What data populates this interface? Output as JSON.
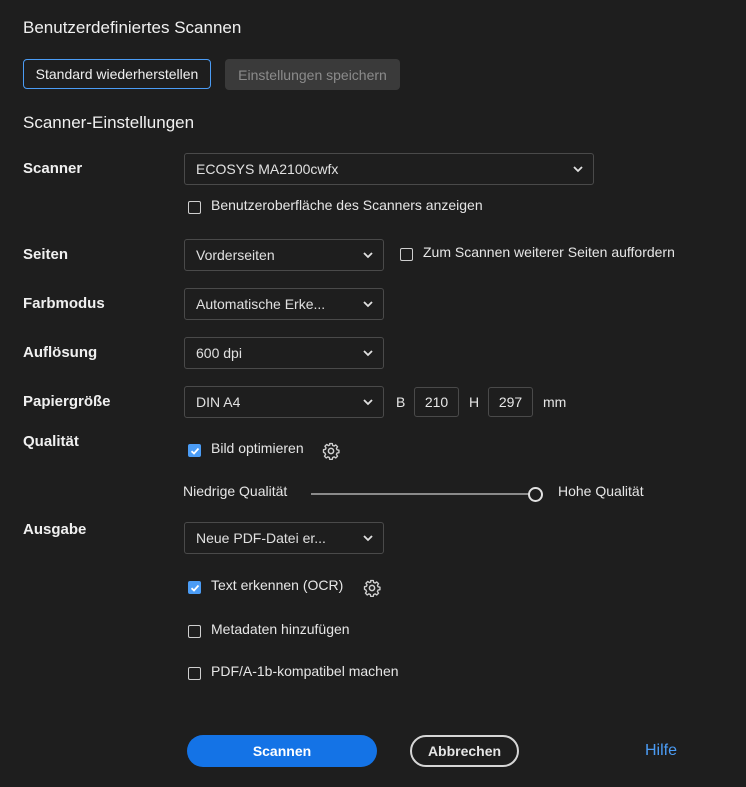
{
  "dialog": {
    "title": "Benutzerdefiniertes Scannen",
    "restore_defaults_label": "Standard wiederherstellen",
    "save_settings_label": "Einstellungen speichern",
    "section_title": "Scanner-Einstellungen"
  },
  "scanner": {
    "label": "Scanner",
    "value": "ECOSYS MA2100cwfx",
    "show_ui_label": "Benutzeroberfläche des Scanners anzeigen",
    "show_ui_checked": false
  },
  "pages": {
    "label": "Seiten",
    "value": "Vorderseiten",
    "prompt_more_label": "Zum Scannen weiterer Seiten auffordern",
    "prompt_more_checked": false
  },
  "color_mode": {
    "label": "Farbmodus",
    "value": "Automatische Erke..."
  },
  "resolution": {
    "label": "Auflösung",
    "value": "600 dpi"
  },
  "paper_size": {
    "label": "Papiergröße",
    "value": "DIN A4",
    "width_label": "B",
    "width_value": "210",
    "height_label": "H",
    "height_value": "297",
    "unit": "mm"
  },
  "quality": {
    "label": "Qualität",
    "optimize_label": "Bild optimieren",
    "optimize_checked": true,
    "low_label": "Niedrige Qualität",
    "high_label": "Hohe Qualität",
    "slider_value": 1.0
  },
  "output": {
    "label": "Ausgabe",
    "value": "Neue PDF-Datei er...",
    "ocr_label": "Text erkennen (OCR)",
    "ocr_checked": true,
    "metadata_label": "Metadaten hinzufügen",
    "metadata_checked": false,
    "pdfa_label": "PDF/A-1b-kompatibel machen",
    "pdfa_checked": false
  },
  "footer": {
    "scan_label": "Scannen",
    "cancel_label": "Abbrechen",
    "help_label": "Hilfe"
  },
  "colors": {
    "accent": "#1473e6",
    "link": "#4b9cf5",
    "background": "#1e1e1e"
  }
}
